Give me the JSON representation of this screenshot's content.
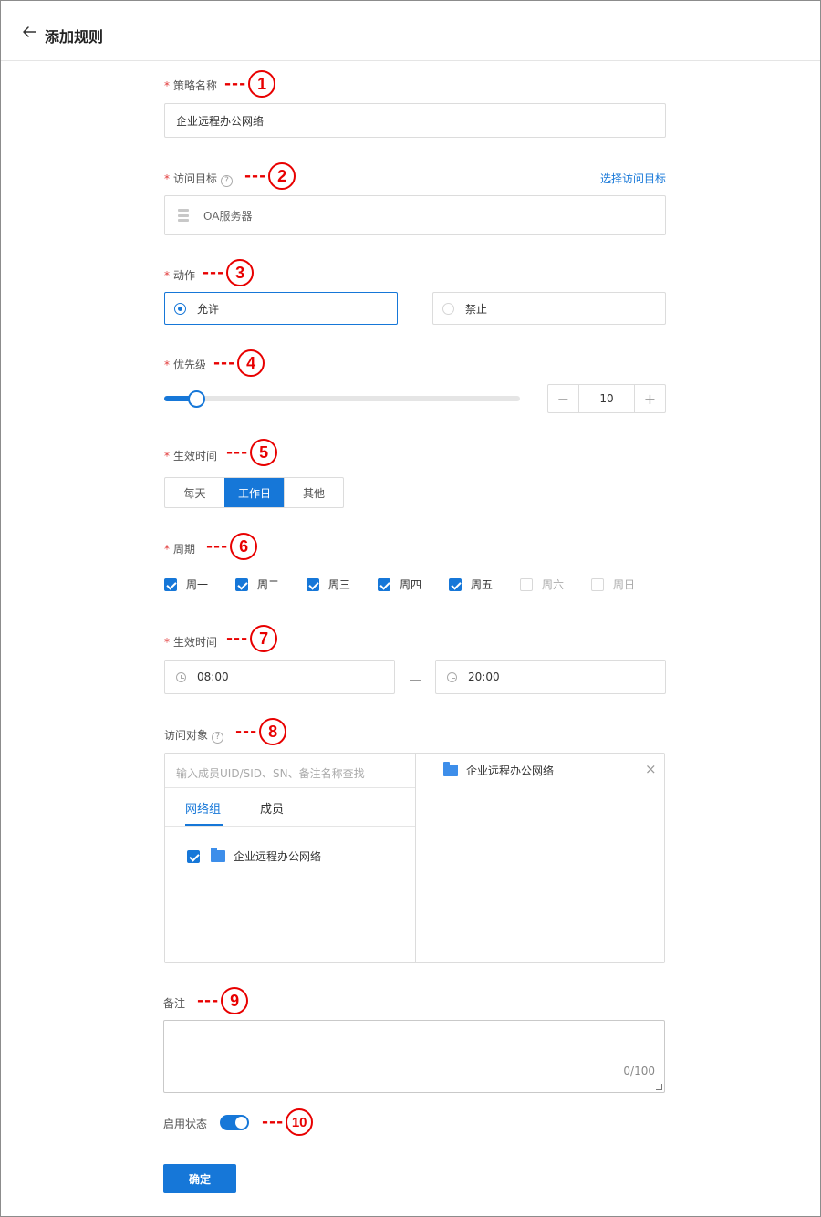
{
  "header": {
    "title": "添加规则"
  },
  "form": {
    "required_mark": "*",
    "policy_name": {
      "label": "策略名称",
      "value": "企业远程办公网络"
    },
    "target": {
      "label": "访问目标",
      "help": "?",
      "link": "选择访问目标",
      "value": "OA服务器"
    },
    "action": {
      "label": "动作",
      "options": [
        "允许",
        "禁止"
      ],
      "selected": "允许"
    },
    "priority": {
      "label": "优先级",
      "value": "10",
      "minus": "−",
      "plus": "+",
      "slider_fraction": 0.09
    },
    "effective_type": {
      "label": "生效时间",
      "options": [
        "每天",
        "工作日",
        "其他"
      ],
      "selected": "工作日"
    },
    "period": {
      "label": "周期",
      "days": [
        {
          "label": "周一",
          "checked": true
        },
        {
          "label": "周二",
          "checked": true
        },
        {
          "label": "周三",
          "checked": true
        },
        {
          "label": "周四",
          "checked": true
        },
        {
          "label": "周五",
          "checked": true
        },
        {
          "label": "周六",
          "checked": false
        },
        {
          "label": "周日",
          "checked": false
        }
      ]
    },
    "effective_time": {
      "label": "生效时间",
      "start": "08:00",
      "end": "20:00"
    },
    "access_object": {
      "label": "访问对象",
      "help": "?",
      "search_placeholder": "输入成员UID/SID、SN、备注名称查找",
      "tabs": [
        "网络组",
        "成员"
      ],
      "active_tab": "网络组",
      "items": [
        {
          "label": "企业远程办公网络",
          "checked": true
        }
      ],
      "selected": [
        {
          "label": "企业远程办公网络",
          "remove": "×"
        }
      ]
    },
    "remark": {
      "label": "备注",
      "counter": "0/100"
    },
    "status": {
      "label": "启用状态",
      "enabled": true
    },
    "submit": "确定"
  },
  "annotations": [
    "1",
    "2",
    "3",
    "4",
    "5",
    "6",
    "7",
    "8",
    "9",
    "10"
  ],
  "annotation_dash": "---",
  "colors": {
    "accent": "#1677d8",
    "annotation": "#e80000",
    "required": "#e23b3b"
  }
}
